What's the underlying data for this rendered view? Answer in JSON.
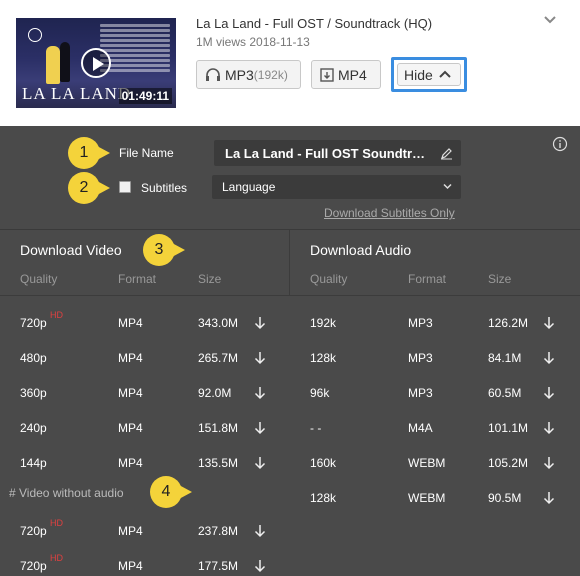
{
  "video": {
    "title": "La La Land - Full OST / Soundtrack (HQ)",
    "meta": "1M views 2018-11-13",
    "thumbnail_logo": "LA LA LAND",
    "duration": "01:49:11"
  },
  "buttons": {
    "mp3_label": "MP3",
    "mp3_bitrate": "(192k)",
    "mp4_label": "MP4",
    "hide_label": "Hide"
  },
  "panel": {
    "file_name_label": "File Name",
    "file_name_value": "La La Land - Full OST  Soundtrack (HQ)",
    "subtitles_label": "Subtitles",
    "language_select": "Language",
    "download_subs_link": "Download Subtitles Only",
    "video_title": "Download Video",
    "audio_title": "Download Audio",
    "headers": {
      "quality": "Quality",
      "format": "Format",
      "size": "Size"
    },
    "video_without_audio": "# Video without audio"
  },
  "callouts": [
    "1",
    "2",
    "3",
    "4"
  ],
  "video_rows": [
    {
      "quality": "720p",
      "hd": "HD",
      "format": "MP4",
      "size": "343.0M"
    },
    {
      "quality": "480p",
      "hd": "",
      "format": "MP4",
      "size": "265.7M"
    },
    {
      "quality": "360p",
      "hd": "",
      "format": "MP4",
      "size": "92.0M"
    },
    {
      "quality": "240p",
      "hd": "",
      "format": "MP4",
      "size": "151.8M"
    },
    {
      "quality": "144p",
      "hd": "",
      "format": "MP4",
      "size": "135.5M"
    }
  ],
  "video_only_rows": [
    {
      "quality": "720p",
      "hd": "HD",
      "format": "MP4",
      "size": "237.8M"
    },
    {
      "quality": "720p",
      "hd": "HD",
      "format": "MP4",
      "size": "177.5M"
    }
  ],
  "audio_rows": [
    {
      "quality": "192k",
      "format": "MP3",
      "size": "126.2M"
    },
    {
      "quality": "128k",
      "format": "MP3",
      "size": "84.1M"
    },
    {
      "quality": "96k",
      "format": "MP3",
      "size": "60.5M"
    },
    {
      "quality": "- -",
      "format": "M4A",
      "size": "101.1M"
    },
    {
      "quality": "160k",
      "format": "WEBM",
      "size": "105.2M"
    },
    {
      "quality": "128k",
      "format": "WEBM",
      "size": "90.5M"
    }
  ],
  "colors": {
    "callout": "#f4d33a",
    "highlight_border": "#3a8de0",
    "panel_bg": "#4a4a4a",
    "hd_badge": "#e04040"
  }
}
